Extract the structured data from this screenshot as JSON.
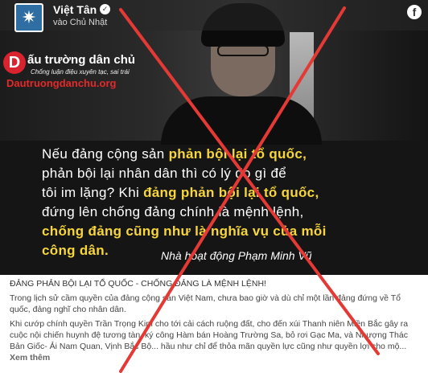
{
  "post": {
    "page_name": "Việt Tân",
    "time": "vào Chủ Nhật",
    "avatar_icon": "star-logo",
    "network_icon": "facebook-icon"
  },
  "watermark": {
    "logo_letter": "D",
    "title": "ấu trường dân chủ",
    "subtitle": "Chống luận điệu xuyên tạc, sai trái",
    "url": "Dautruongdanchu.org"
  },
  "quote": {
    "l1_a": "Nếu đảng cộng sản ",
    "l1_b": "phản bội lại tổ quốc,",
    "l2": "phản bội lại nhân dân thì có lý do gì để",
    "l3_a": "tôi im lặng? Khi ",
    "l3_b": "đảng phản bội lại tổ quốc,",
    "l4": "đứng lên chống đảng chính là mệnh lệnh,",
    "l5": "chống đảng cũng như là nghĩa vụ của mỗi",
    "l6": "công dân.",
    "author": "Nhà hoạt động Phạm Minh Vũ"
  },
  "caption": {
    "title": "ĐẢNG PHẢN BỘI LẠI TỔ QUỐC - CHỐNG ĐẢNG LÀ MỆNH LỆNH!",
    "p1": "Trong lịch sử cầm quyền của đảng cộng sản Việt Nam, chưa bao giờ và dù chỉ một lần đảng đứng về Tổ quốc, đảng nghĩ cho nhân dân.",
    "p2": "Khi cướp chính quyền Trần Trọng Kim cho tới cải cách ruộng đất, cho đến xúi Thanh niên Miền Bắc gây ra cuộc nội chiến huynh đệ tương tàn, ký công Hàm bán Hoàng Trường Sa, bỏ rơi Gạc Ma, và Nhượng Thác Bản Giốc- Ải Nam Quan, Vịnh Bắc Bộ... hầu như chỉ để thỏa mãn quyền lực cũng như quyền lợi cho mộ...",
    "see_more": "Xem thêm"
  },
  "overlay": {
    "x_color": "#e53935"
  }
}
